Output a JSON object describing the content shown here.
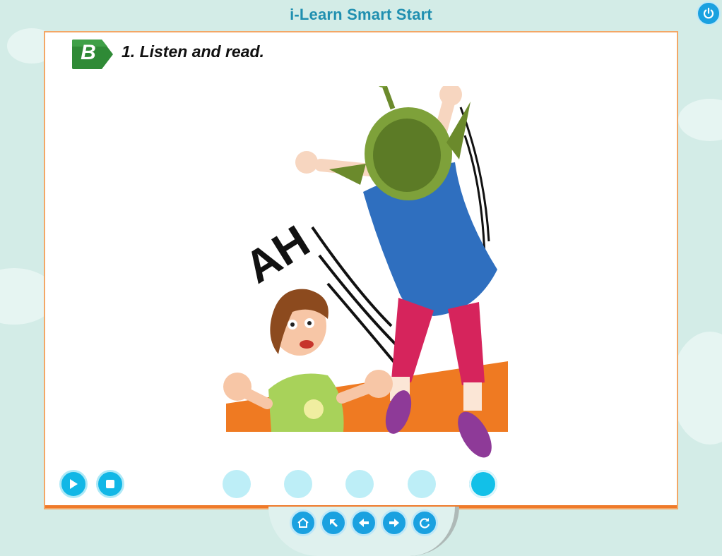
{
  "app": {
    "title": "i-Learn Smart Start",
    "power_icon": "power-icon"
  },
  "lesson": {
    "section_letter": "B",
    "instruction": "1. Listen and read.",
    "exclamation": "AH"
  },
  "controls": {
    "play_icon": "play-icon",
    "stop_icon": "stop-icon",
    "pages_total": 5,
    "active_page": 5
  },
  "nav": {
    "items": [
      {
        "icon": "home-icon"
      },
      {
        "icon": "arrow-up-left-icon"
      },
      {
        "icon": "arrow-left-icon"
      },
      {
        "icon": "arrow-right-icon"
      },
      {
        "icon": "refresh-icon"
      }
    ]
  },
  "colors": {
    "accent": "#12b7e6",
    "badge_green": "#2f8a36",
    "frame_orange": "#f3a766"
  }
}
